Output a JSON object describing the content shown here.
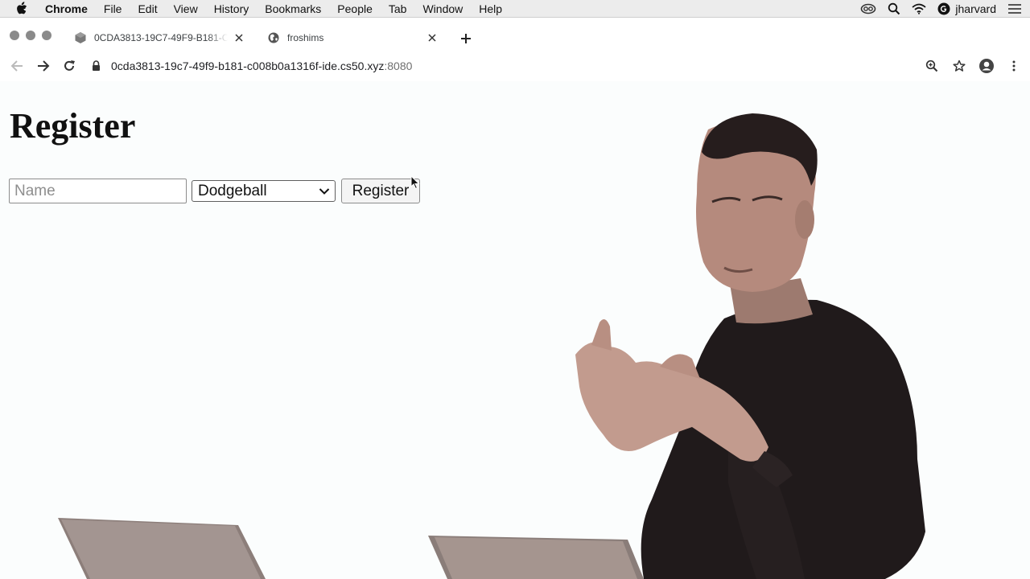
{
  "menubar": {
    "app_name": "Chrome",
    "items": [
      "File",
      "Edit",
      "View",
      "History",
      "Bookmarks",
      "People",
      "Tab",
      "Window",
      "Help"
    ],
    "user": "jharvard",
    "icons": [
      "apple-icon",
      "creative-cloud-icon",
      "spotlight-search-icon",
      "wifi-icon",
      "user-g-icon",
      "control-center-icon"
    ]
  },
  "tabs": [
    {
      "title": "0CDA3813-19C7-49F9-B181-C0",
      "active": true,
      "favicon": "cube-icon"
    },
    {
      "title": "froshims",
      "active": false,
      "favicon": "globe-icon"
    }
  ],
  "toolbar": {
    "url_host": "0cda3813-19c7-49f9-b181-c008b0a1316f-ide.cs50.xyz",
    "url_port": ":8080"
  },
  "page": {
    "heading": "Register",
    "name_placeholder": "Name",
    "sport_selected": "Dodgeball",
    "submit_label": "Register"
  },
  "colors": {
    "menubar_bg": "#ececec",
    "page_bg": "#fbfdfd",
    "text": "#111111",
    "presenter_shirt": "#201a1b"
  }
}
